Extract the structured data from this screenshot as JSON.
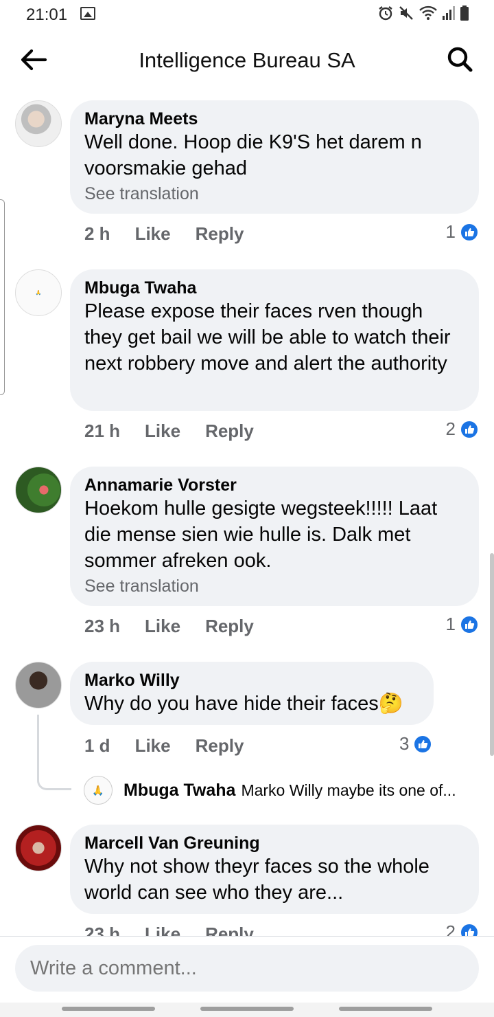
{
  "status_bar": {
    "time": "21:01"
  },
  "header": {
    "title": "Intelligence Bureau SA"
  },
  "comments": [
    {
      "author": "Maryna Meets",
      "text": "Well done. Hoop die K9'S het darem n voorsmakie gehad",
      "see_translation": "See translation",
      "time": "2 h",
      "like_label": "Like",
      "reply_label": "Reply",
      "likes": "1"
    },
    {
      "author": "Mbuga Twaha",
      "text": "Please expose their faces rven though they get bail we will be able to watch their next robbery move and alert the authority",
      "time": "21 h",
      "like_label": "Like",
      "reply_label": "Reply",
      "likes": "2"
    },
    {
      "author": "Annamarie Vorster",
      "text": "Hoekom hulle gesigte wegsteek!!!!! Laat die mense sien wie hulle is. Dalk met sommer afreken ook.",
      "see_translation": "See translation",
      "time": "23 h",
      "like_label": "Like",
      "reply_label": "Reply",
      "likes": "1"
    },
    {
      "author": "Marko Willy",
      "text": "Why do you have hide their faces🤔",
      "time": "1 d",
      "like_label": "Like",
      "reply_label": "Reply",
      "likes": "3",
      "reply_preview": {
        "author": "Mbuga Twaha",
        "text": "Marko Willy maybe its one of..."
      }
    },
    {
      "author": "Marcell Van Greuning",
      "text": "Why not show theyr faces so the whole world can see who  they are...",
      "time": "23 h",
      "like_label": "Like",
      "reply_label": "Reply",
      "likes": "2"
    }
  ],
  "composer": {
    "placeholder": "Write a comment..."
  },
  "colors": {
    "bubble": "#f0f2f5",
    "like_blue": "#1b74e4",
    "meta_gray": "#65676b"
  },
  "icons": [
    "back-arrow-icon",
    "search-icon",
    "gallery-icon",
    "alarm-icon",
    "mute-icon",
    "wifi-icon",
    "signal-icon",
    "battery-icon",
    "like-thumb-icon"
  ]
}
